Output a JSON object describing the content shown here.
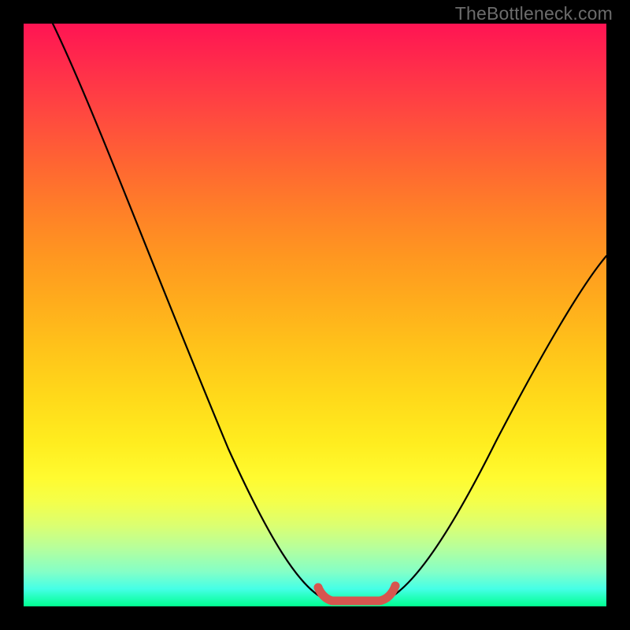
{
  "watermark": "TheBottleneck.com",
  "chart_data": {
    "type": "line",
    "title": "",
    "xlabel": "",
    "ylabel": "",
    "xlim": [
      0,
      100
    ],
    "ylim": [
      0,
      100
    ],
    "grid": false,
    "legend": false,
    "axes_visible": false,
    "background": "rainbow-vertical-gradient",
    "series": [
      {
        "name": "bottleneck-curve",
        "color": "#000000",
        "x": [
          5,
          10,
          15,
          20,
          25,
          30,
          35,
          40,
          45,
          50,
          52,
          55,
          58,
          60,
          62,
          65,
          68,
          72,
          78,
          85,
          92,
          100
        ],
        "y": [
          100,
          90,
          80,
          69,
          58,
          47,
          36,
          25,
          15,
          7,
          3,
          0,
          0,
          0,
          2,
          6,
          12,
          20,
          30,
          40,
          49,
          57
        ]
      },
      {
        "name": "bottom-marker",
        "color": "#d6564f",
        "style": "thick-rounded",
        "x": [
          50,
          52,
          54,
          56,
          58,
          60,
          62
        ],
        "y": [
          3,
          1,
          0,
          0,
          0,
          1,
          3
        ]
      }
    ],
    "note": "No numeric axis labels or tick marks are visible in the image; x/y values are normalized 0–100 estimates based on pixel positions within the plot area."
  }
}
